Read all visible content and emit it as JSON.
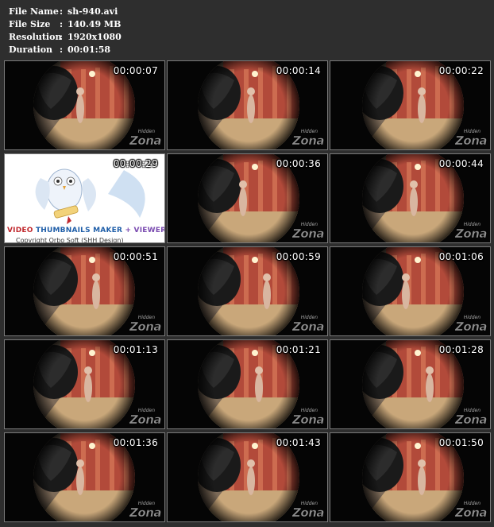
{
  "info": [
    {
      "label": "File Name",
      "value": "sh-940.avi"
    },
    {
      "label": "File Size",
      "value": "140.49 MB"
    },
    {
      "label": "Resolution",
      "value": "1920x1080"
    },
    {
      "label": "Duration",
      "value": "00:01:58"
    }
  ],
  "separator": ":",
  "watermark": {
    "small": "Hidden",
    "big": "Zona"
  },
  "promo": {
    "part1": "VIDEO",
    "part2": "THUMBNAILS MAKER",
    "part3": "+ VIEWER",
    "line2": "Copyright Orbo Soft (SHH Design)"
  },
  "thumbnails": [
    {
      "time": "00:00:07"
    },
    {
      "time": "00:00:14"
    },
    {
      "time": "00:00:22"
    },
    {
      "time": "00:00:29",
      "promo": true
    },
    {
      "time": "00:00:36"
    },
    {
      "time": "00:00:44"
    },
    {
      "time": "00:00:51"
    },
    {
      "time": "00:00:59"
    },
    {
      "time": "00:01:06"
    },
    {
      "time": "00:01:13"
    },
    {
      "time": "00:01:21"
    },
    {
      "time": "00:01:28"
    },
    {
      "time": "00:01:36"
    },
    {
      "time": "00:01:43"
    },
    {
      "time": "00:01:50"
    }
  ],
  "colors": {
    "background": "#2e2e2e",
    "frame_border": "#7a7a7a",
    "wall": "#b24a3a",
    "floor": "#c9a77a"
  }
}
